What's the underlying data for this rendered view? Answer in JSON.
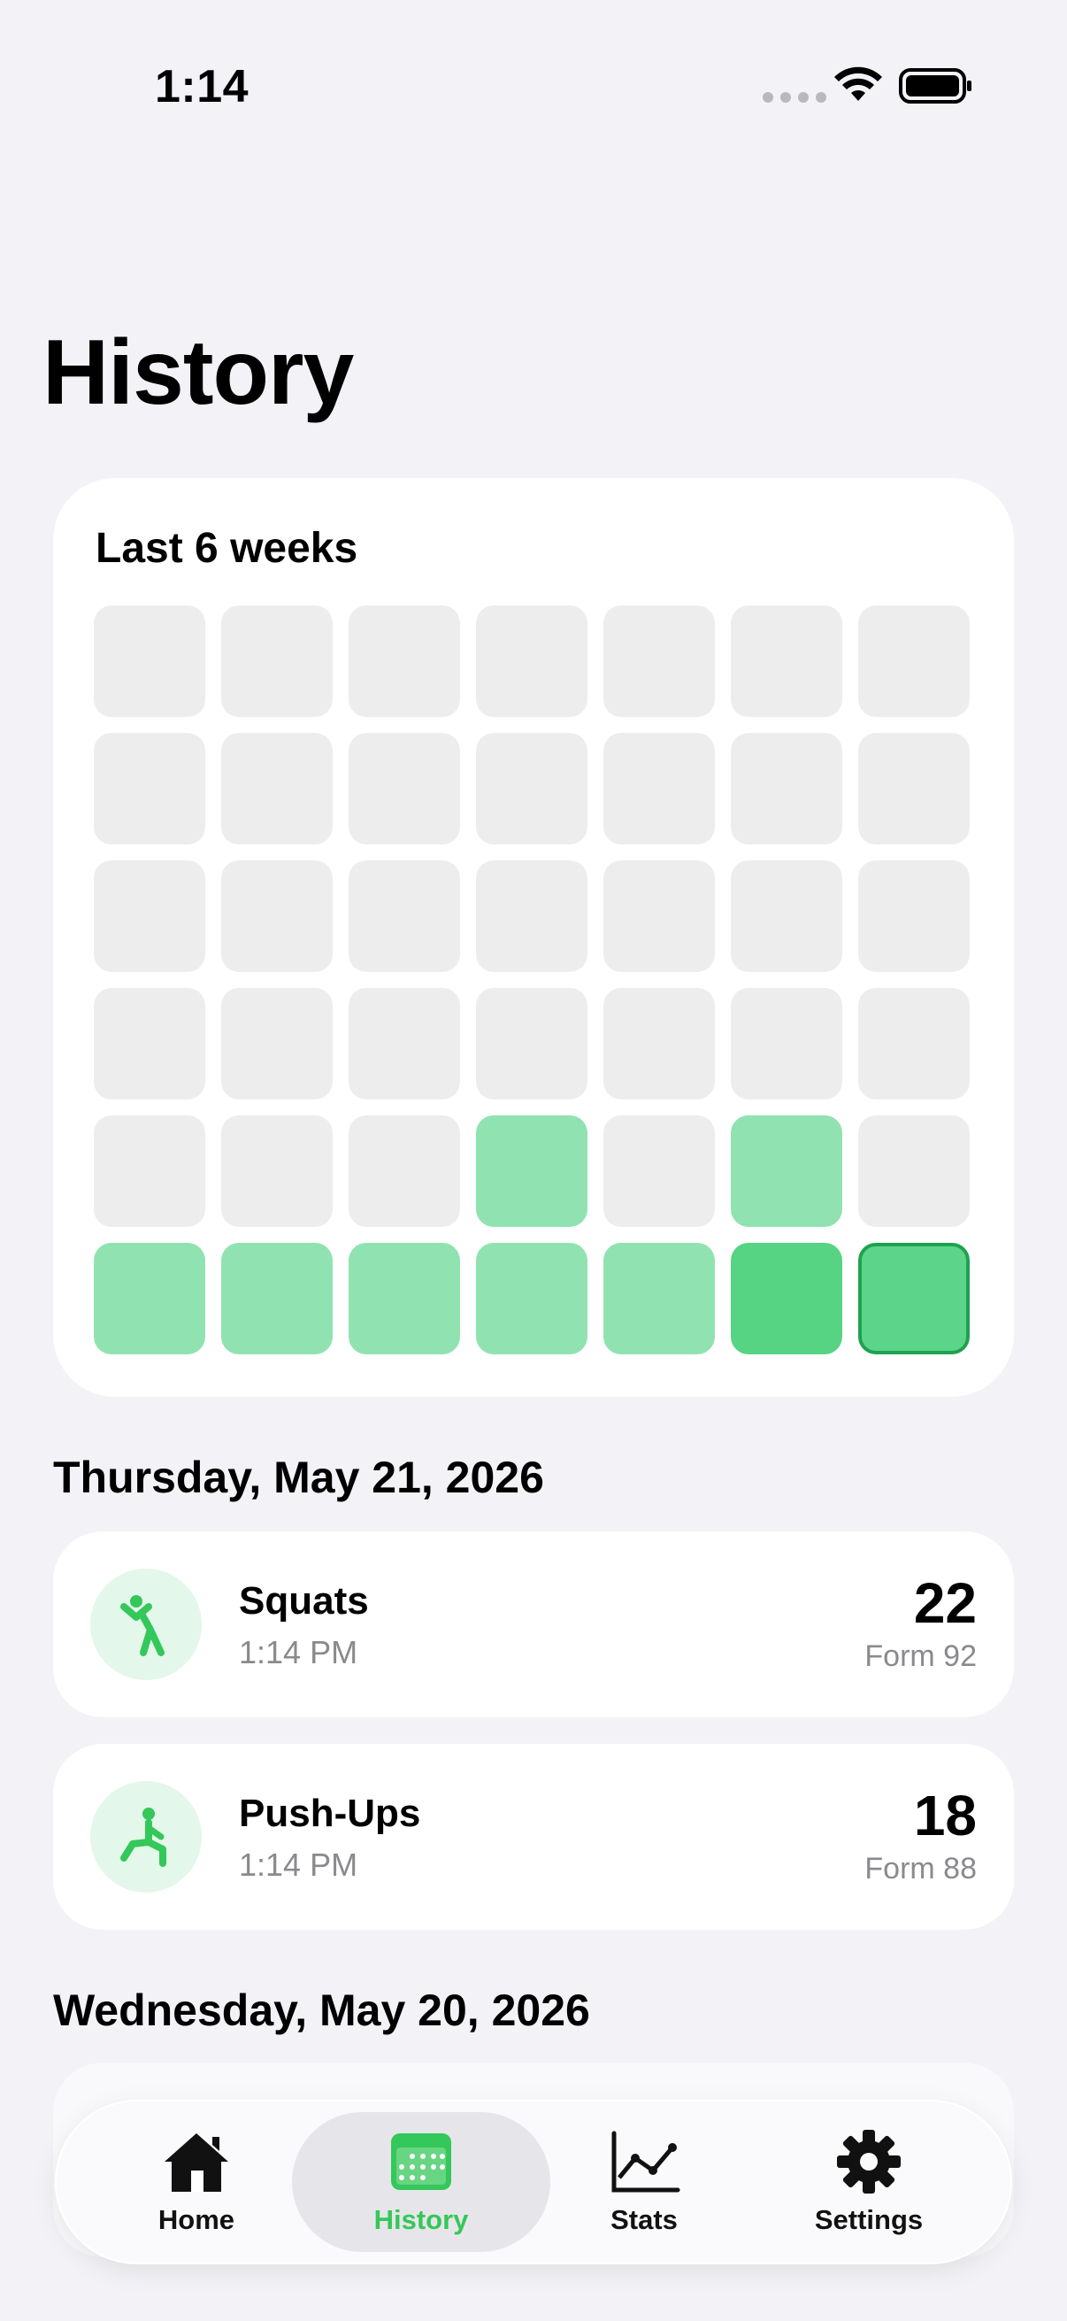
{
  "status": {
    "time": "1:14"
  },
  "title": "History",
  "heatmap": {
    "title": "Last 6 weeks",
    "rows": [
      [
        0,
        0,
        0,
        0,
        0,
        0,
        0
      ],
      [
        0,
        0,
        0,
        0,
        0,
        0,
        0
      ],
      [
        0,
        0,
        0,
        0,
        0,
        0,
        0
      ],
      [
        0,
        0,
        0,
        0,
        0,
        0,
        0
      ],
      [
        0,
        0,
        0,
        1,
        0,
        1,
        0
      ],
      [
        1,
        1,
        1,
        1,
        1,
        2,
        3
      ]
    ]
  },
  "days": [
    {
      "header": "Thursday, May 21, 2026",
      "sessions": [
        {
          "name": "Squats",
          "time": "1:14 PM",
          "count": "22",
          "form": "Form 92",
          "icon": "stretch-figure-icon"
        },
        {
          "name": "Push-Ups",
          "time": "1:14 PM",
          "count": "18",
          "form": "Form 88",
          "icon": "lunge-figure-icon"
        }
      ]
    },
    {
      "header": "Wednesday, May 20, 2026",
      "sessions": []
    }
  ],
  "tabs": [
    {
      "label": "Home",
      "icon": "house-icon"
    },
    {
      "label": "History",
      "icon": "calendar-icon"
    },
    {
      "label": "Stats",
      "icon": "line-chart-icon"
    },
    {
      "label": "Settings",
      "icon": "gear-icon"
    }
  ],
  "colors": {
    "accent": "#34c759",
    "level1": "#90e3b0",
    "level2": "#56d484",
    "empty": "#ededed"
  }
}
